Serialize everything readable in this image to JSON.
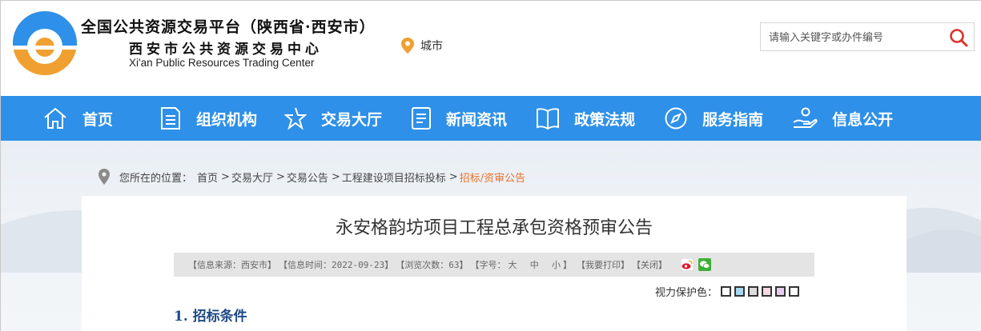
{
  "header": {
    "org_cn_line1": "全国公共资源交易平台（陕西省·西安市）",
    "org_cn_line2": "西安市公共资源交易中心",
    "org_en": "Xi'an Public Resources Trading Center",
    "city_label": "城市",
    "search_placeholder": "请输入关键字或办件编号",
    "brand_colors": {
      "blue": "#2e90e8",
      "orange": "#f0a030",
      "accent_orange": "#e8712b"
    }
  },
  "nav": {
    "items": [
      {
        "label": "首页",
        "icon": "home-icon"
      },
      {
        "label": "组织机构",
        "icon": "document-icon"
      },
      {
        "label": "交易大厅",
        "icon": "star-icon"
      },
      {
        "label": "新闻资讯",
        "icon": "news-icon"
      },
      {
        "label": "政策法规",
        "icon": "book-icon"
      },
      {
        "label": "服务指南",
        "icon": "compass-icon"
      },
      {
        "label": "信息公开",
        "icon": "hand-icon"
      }
    ]
  },
  "breadcrumb": {
    "prefix": "您所在的位置：",
    "items": [
      "首页",
      "交易大厅",
      "交易公告",
      "工程建设项目招标投标",
      "招标/资审公告"
    ]
  },
  "article": {
    "title": "永安格韵坊项目工程总承包资格预审公告",
    "meta": {
      "source": "【信息来源：西安市】",
      "time": "【信息时间：2022-09-23】",
      "views": "【浏览次数：63】",
      "font_prefix": "【字号：",
      "font_large": "大",
      "font_medium": "中",
      "font_small": "小",
      "font_suffix": "】",
      "print": "【我要打印】",
      "close": "【关闭】"
    },
    "eye_protect_label": "视力保护色：",
    "eye_colors": [
      "#ffffff",
      "#a8d8f0",
      "#dcdcdc",
      "#f6d8e0",
      "#e6cdf0",
      "#ffffff"
    ],
    "section1": "1. 招标条件"
  }
}
